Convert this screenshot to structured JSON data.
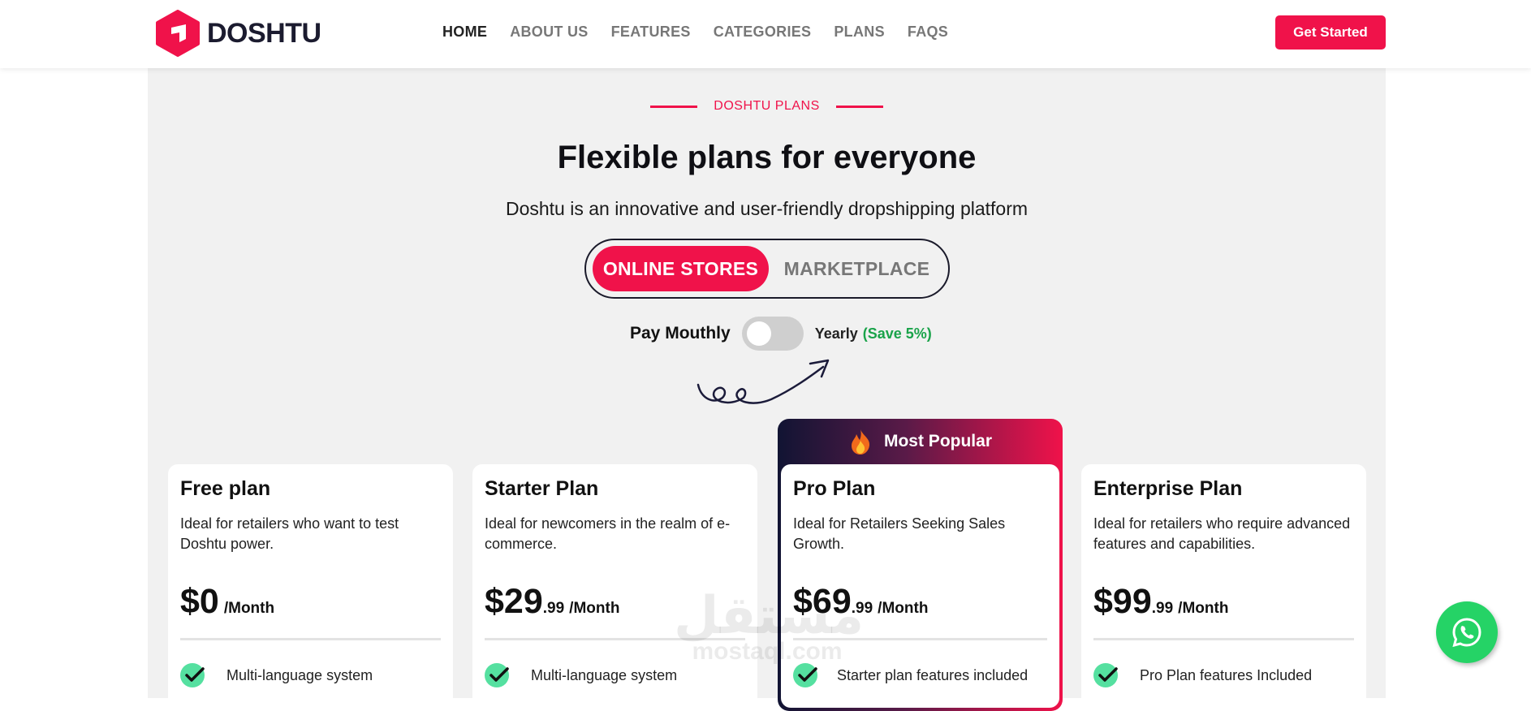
{
  "brand": {
    "name": "DOSHTU",
    "accent": "#f0124a"
  },
  "nav": {
    "items": [
      {
        "label": "HOME",
        "active": true
      },
      {
        "label": "ABOUT US"
      },
      {
        "label": "FEATURES"
      },
      {
        "label": "CATEGORIES"
      },
      {
        "label": "PLANS"
      },
      {
        "label": "FAQS"
      }
    ],
    "cta_label": "Get Started"
  },
  "hero": {
    "eyebrow": "DOSHTU PLANS",
    "title": "Flexible plans for everyone",
    "subtitle": "Doshtu is an innovative and user-friendly dropshipping platform",
    "segments": [
      "ONLINE STORES",
      "MARKETPLACE"
    ],
    "billing": {
      "monthly_label": "Pay Mouthly",
      "yearly_label": "Yearly",
      "save_label": "(Save 5%)",
      "yearly_selected": false
    }
  },
  "plans": [
    {
      "name": "Free plan",
      "desc": "Ideal for retailers who want to test Doshtu power.",
      "price": "$0",
      "cents": "",
      "unit": "/Month",
      "feature": "Multi-language system"
    },
    {
      "name": "Starter Plan",
      "desc": "Ideal for newcomers in the realm of e-commerce.",
      "price": "$29",
      "cents": ".99",
      "unit": "/Month",
      "feature": "Multi-language system"
    },
    {
      "name": "Pro Plan",
      "desc": "Ideal for Retailers Seeking Sales Growth.",
      "price": "$69",
      "cents": ".99",
      "unit": "/Month",
      "feature": "Starter plan features included",
      "badge": "Most Popular"
    },
    {
      "name": "Enterprise Plan",
      "desc": "Ideal for retailers who require advanced features and capabilities.",
      "price": "$99",
      "cents": ".99",
      "unit": "/Month",
      "feature": "Pro Plan features Included"
    }
  ],
  "watermark": {
    "arabic": "مستقل",
    "latin": "mostaql.com"
  },
  "icons": {
    "whatsapp": "whatsapp-icon",
    "flame": "flame-icon",
    "check": "check-icon"
  }
}
